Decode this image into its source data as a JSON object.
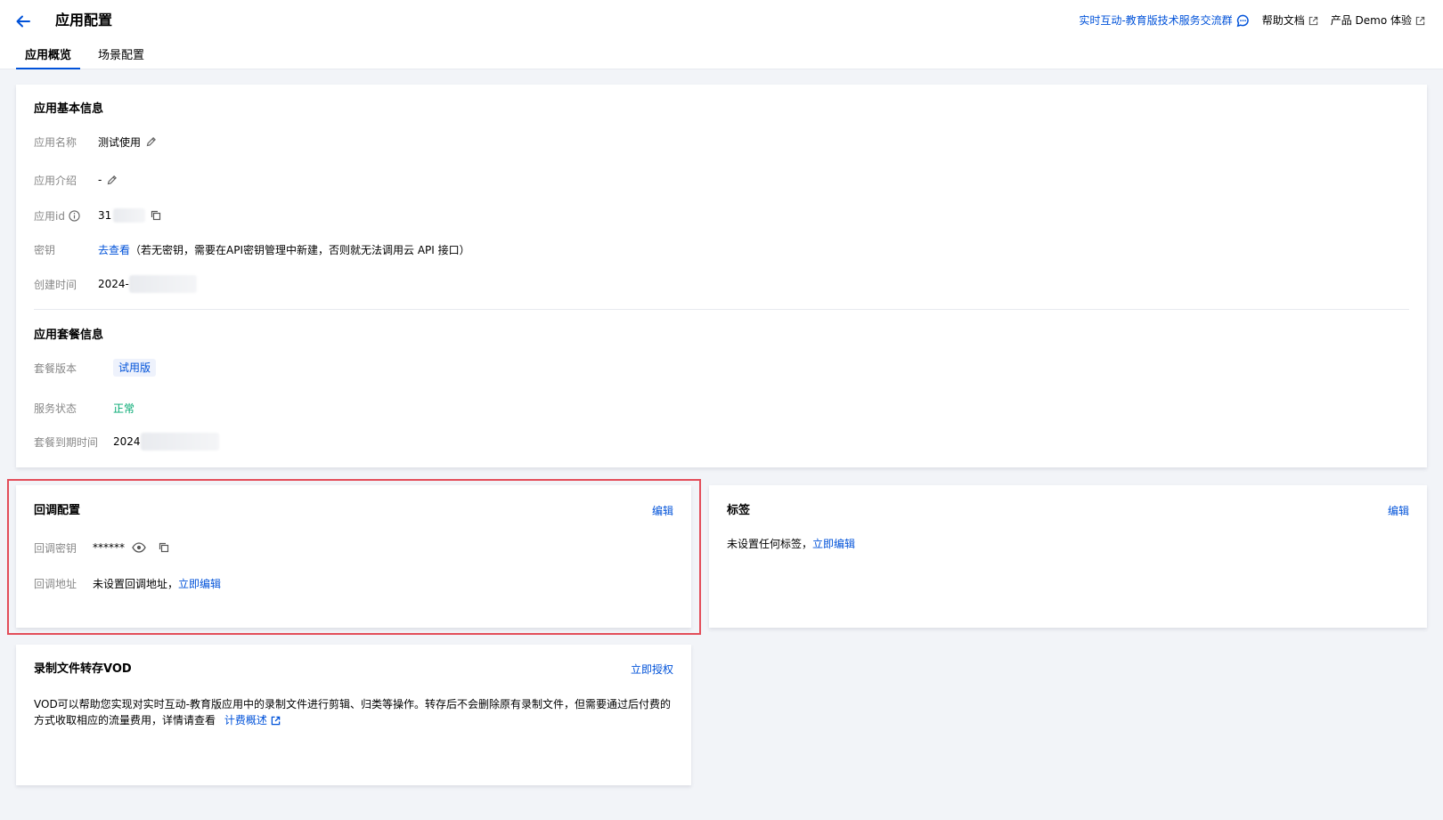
{
  "header": {
    "title": "应用配置",
    "links": {
      "community": "实时互动-教育版技术服务交流群",
      "help": "帮助文档",
      "demo": "产品 Demo 体验"
    },
    "tabs": [
      "应用概览",
      "场景配置"
    ]
  },
  "basic_info": {
    "title": "应用基本信息",
    "name_label": "应用名称",
    "name_value": "测试使用",
    "intro_label": "应用介绍",
    "intro_value": "-",
    "id_label": "应用id",
    "id_value": "31",
    "key_label": "密钥",
    "key_link": "去查看",
    "key_note": "（若无密钥，需要在API密钥管理中新建，否则就无法调用云 API 接口）",
    "created_label": "创建时间",
    "created_value": "2024-"
  },
  "package_info": {
    "title": "应用套餐信息",
    "version_label": "套餐版本",
    "version_value": "试用版",
    "status_label": "服务状态",
    "status_value": "正常",
    "expire_label": "套餐到期时间",
    "expire_value": "2024"
  },
  "callback": {
    "title": "回调配置",
    "edit": "编辑",
    "secret_label": "回调密钥",
    "secret_value": "******",
    "url_label": "回调地址",
    "url_value": "未设置回调地址，",
    "url_link": "立即编辑"
  },
  "tags": {
    "title": "标签",
    "edit": "编辑",
    "empty_text": "未设置任何标签，",
    "empty_link": "立即编辑"
  },
  "vod": {
    "title": "录制文件转存VOD",
    "action": "立即授权",
    "description": "VOD可以帮助您实现对实时互动-教育版应用中的录制文件进行剪辑、归类等操作。转存后不会删除原有录制文件，但需要通过后付费的方式收取相应的流量费用，详情请查看",
    "link": "计费概述"
  },
  "colors": {
    "accent": "#0052d9",
    "success": "#00a870",
    "highlight": "#e34d59",
    "label": "#888888"
  }
}
